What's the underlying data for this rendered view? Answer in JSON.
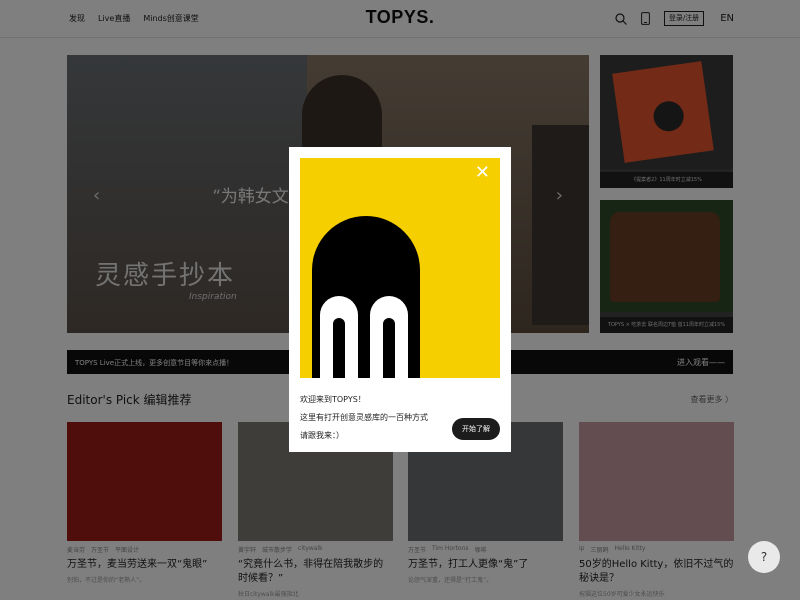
{
  "header": {
    "nav": [
      "发现",
      "Live直播",
      "Minds创意课堂"
    ],
    "logo": "TOPYS.",
    "login_label": "登录/注册",
    "lang_label": "EN"
  },
  "hero": {
    "title": "“为韩女文",
    "subtitle": "灵感手抄本",
    "inspiration": "Inspiration"
  },
  "side_cards": [
    {
      "caption": "《提案者2》11周年时立减15%"
    },
    {
      "caption": "TOPYS × 吃茶去 联名周边T恤 首11周年时立减15%"
    }
  ],
  "banner": {
    "text": "TOPYS Live正式上线，更多创意节目等你来点播！",
    "link": "进入观看——"
  },
  "editors_pick": {
    "title": "Editor's Pick 编辑推荐",
    "more": "查看更多 〉"
  },
  "cards": [
    {
      "tags": [
        "麦当劳",
        "万圣节",
        "平面设计"
      ],
      "title": "万圣节，麦当劳送来一双“鬼眼”",
      "sub": "别怕，不过是你的“老熟人”。"
    },
    {
      "tags": [
        "黄宇轩",
        "城市散步学",
        "citywalk"
      ],
      "title": "“究竟什么书，非得在陪我散步的时候看？”",
      "sub": "秋日citywalk最强指北"
    },
    {
      "tags": [
        "万圣节",
        "Tim Hortons",
        "咖啡"
      ],
      "title": "万圣节，打工人更像“鬼”了",
      "sub": "论怨气深重，还得是“打工鬼”。"
    },
    {
      "tags": [
        "ip",
        "三丽鸥",
        "Hello Kitty"
      ],
      "title": "50岁的Hello Kitty，依旧不过气的秘诀是？",
      "sub": "祝福这位50岁可爱少女永远快乐"
    }
  ],
  "modal": {
    "line1": "欢迎来到TOPYS！",
    "line2": "这里有打开创意灵感库的一百种方式",
    "line3": "请跟我来：）",
    "button": "开始了解",
    "close": "✕"
  },
  "help_label": "?",
  "colors": {
    "accent": "#f5cf00",
    "dark": "#111111"
  }
}
